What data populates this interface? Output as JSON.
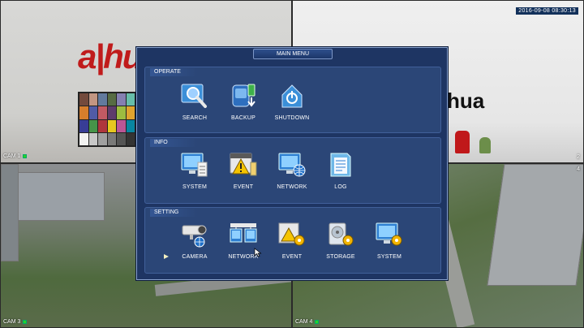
{
  "timestamp": "2016-09-08 08:30:13",
  "cameras": [
    {
      "label": "CAM 1",
      "channel": "1"
    },
    {
      "label": "",
      "channel": "2"
    },
    {
      "label": "CAM 3",
      "channel": "3"
    },
    {
      "label": "CAM 4",
      "channel": "4"
    }
  ],
  "menu": {
    "title": "MAIN MENU",
    "sections": {
      "operate": {
        "title": "OPERATE",
        "items": [
          {
            "label": "SEARCH",
            "icon": "search-icon"
          },
          {
            "label": "BACKUP",
            "icon": "backup-icon"
          },
          {
            "label": "SHUTDOWN",
            "icon": "shutdown-icon"
          }
        ]
      },
      "info": {
        "title": "INFO",
        "items": [
          {
            "label": "SYSTEM",
            "icon": "system-info-icon"
          },
          {
            "label": "EVENT",
            "icon": "event-info-icon"
          },
          {
            "label": "NETWORK",
            "icon": "network-info-icon"
          },
          {
            "label": "LOG",
            "icon": "log-icon"
          }
        ]
      },
      "setting": {
        "title": "SETTING",
        "items": [
          {
            "label": "CAMERA",
            "icon": "camera-settings-icon"
          },
          {
            "label": "NETWORK",
            "icon": "network-settings-icon"
          },
          {
            "label": "EVENT",
            "icon": "event-settings-icon"
          },
          {
            "label": "STORAGE",
            "icon": "storage-settings-icon"
          },
          {
            "label": "SYSTEM",
            "icon": "system-settings-icon"
          }
        ]
      }
    }
  },
  "colors": {
    "menu_bg": "#1e3563",
    "section_bg": "#2b4677",
    "record_indicator": "#27d427",
    "brand_red": "#c01b1b"
  }
}
